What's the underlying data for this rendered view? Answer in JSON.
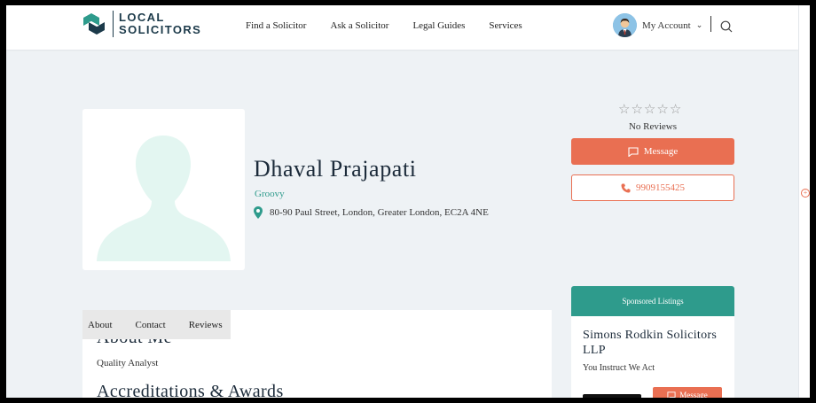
{
  "brand": {
    "line1": "LOCAL",
    "line2": "SOLICITORS"
  },
  "nav": [
    "Find a Solicitor",
    "Ask a Solicitor",
    "Legal Guides",
    "Services"
  ],
  "account": {
    "label": "My Account"
  },
  "profile": {
    "name": "Dhaval Prajapati",
    "tagline": "Groovy",
    "address": "80-90 Paul Street, London, Greater London, EC2A 4NE"
  },
  "rating": {
    "stars_filled": 0,
    "stars_total": 5,
    "reviews_text": "No Reviews"
  },
  "actions": {
    "message_label": "Message",
    "phone": "9909155425"
  },
  "tabs": [
    "About",
    "Contact",
    "Reviews"
  ],
  "sections": {
    "about_heading": "About Me",
    "about_text": "Quality Analyst",
    "accreditations_heading": "Accreditations & Awards"
  },
  "sponsored": {
    "title": "Sponsored Listings",
    "firm_name": "Simons Rodkin Solicitors LLP",
    "firm_tagline": "You Instruct We Act",
    "message_label": "Message"
  },
  "colors": {
    "accent": "#e96f52",
    "teal": "#2e9b8c",
    "navy": "#1c3a4a",
    "background": "#eef2f5"
  },
  "icons": [
    "logo-icon",
    "user-avatar-icon",
    "chevron-down-icon",
    "search-icon",
    "location-pin-icon",
    "star-icon",
    "message-icon",
    "phone-icon",
    "placeholder-person-icon"
  ]
}
